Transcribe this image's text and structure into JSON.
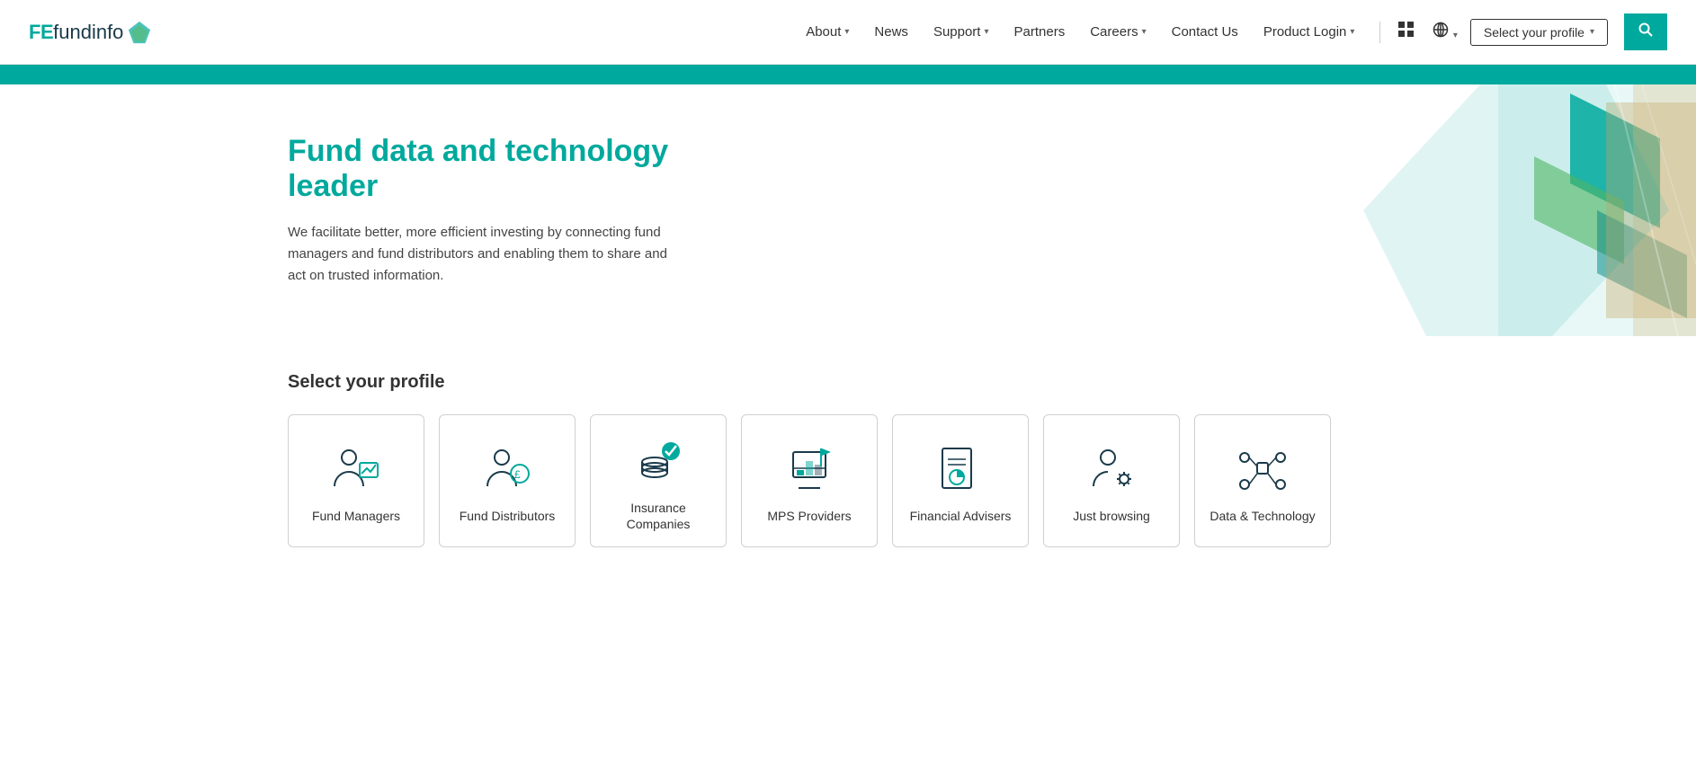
{
  "navbar": {
    "logo_fe": "FE",
    "logo_fundinfo": " fundinfo",
    "links": [
      {
        "label": "About",
        "has_dropdown": true,
        "name": "about"
      },
      {
        "label": "News",
        "has_dropdown": false,
        "name": "news"
      },
      {
        "label": "Support",
        "has_dropdown": true,
        "name": "support"
      },
      {
        "label": "Partners",
        "has_dropdown": false,
        "name": "partners"
      },
      {
        "label": "Careers",
        "has_dropdown": true,
        "name": "careers"
      },
      {
        "label": "Contact Us",
        "has_dropdown": false,
        "name": "contact-us"
      },
      {
        "label": "Product Login",
        "has_dropdown": true,
        "name": "product-login"
      }
    ],
    "select_profile_label": "Select your profile",
    "grid_icon": "⊞",
    "globe_icon": "🌐"
  },
  "hero": {
    "title": "Fund data and technology leader",
    "description": "We facilitate better, more efficient investing by connecting fund managers and fund distributors and enabling them to share and act on trusted information."
  },
  "profile_section": {
    "title": "Select your profile",
    "cards": [
      {
        "label": "Fund Managers",
        "name": "fund-managers"
      },
      {
        "label": "Fund Distributors",
        "name": "fund-distributors"
      },
      {
        "label": "Insurance Companies",
        "name": "insurance-companies"
      },
      {
        "label": "MPS Providers",
        "name": "mps-providers"
      },
      {
        "label": "Financial Advisers",
        "name": "financial-advisers"
      },
      {
        "label": "Just browsing",
        "name": "just-browsing"
      },
      {
        "label": "Data & Technology",
        "name": "data-technology"
      }
    ]
  }
}
